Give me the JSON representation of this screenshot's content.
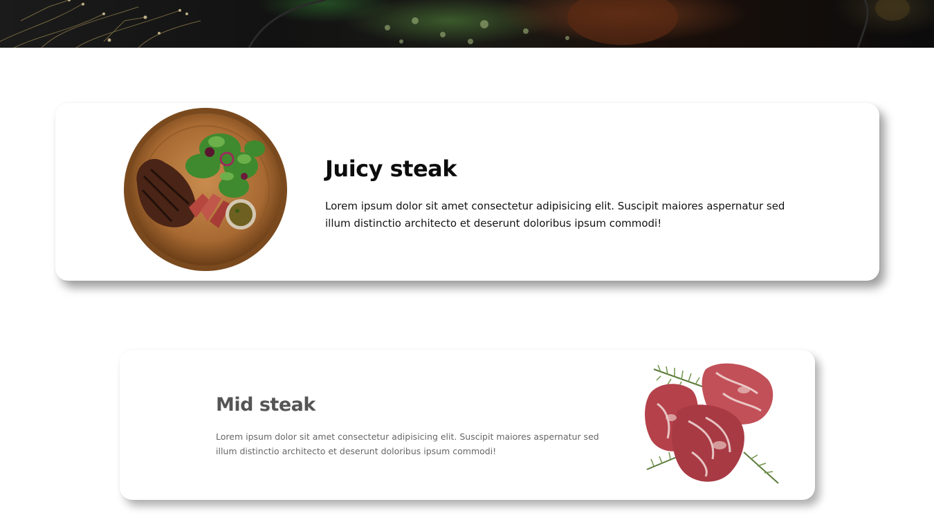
{
  "hero": {
    "icon": "food-photo-banner"
  },
  "cards": [
    {
      "title": "Juicy steak",
      "description": "Lorem ipsum dolor sit amet consectetur adipisicing elit. Suscipit maiores aspernatur sed illum distinctio architecto et deserunt doloribus ipsum commodi!",
      "image": "steak-plate-image"
    },
    {
      "title": "Mid steak",
      "description": "Lorem ipsum dolor sit amet consectetur adipisicing elit. Suscipit maiores aspernatur sed illum distinctio architecto et deserunt doloribus ipsum commodi!",
      "image": "raw-steak-image"
    }
  ],
  "colors": {
    "card_background": "#ffffff",
    "title_primary": "#0c0c0c",
    "title_secondary": "#555555",
    "hero_dark": "#121212"
  }
}
